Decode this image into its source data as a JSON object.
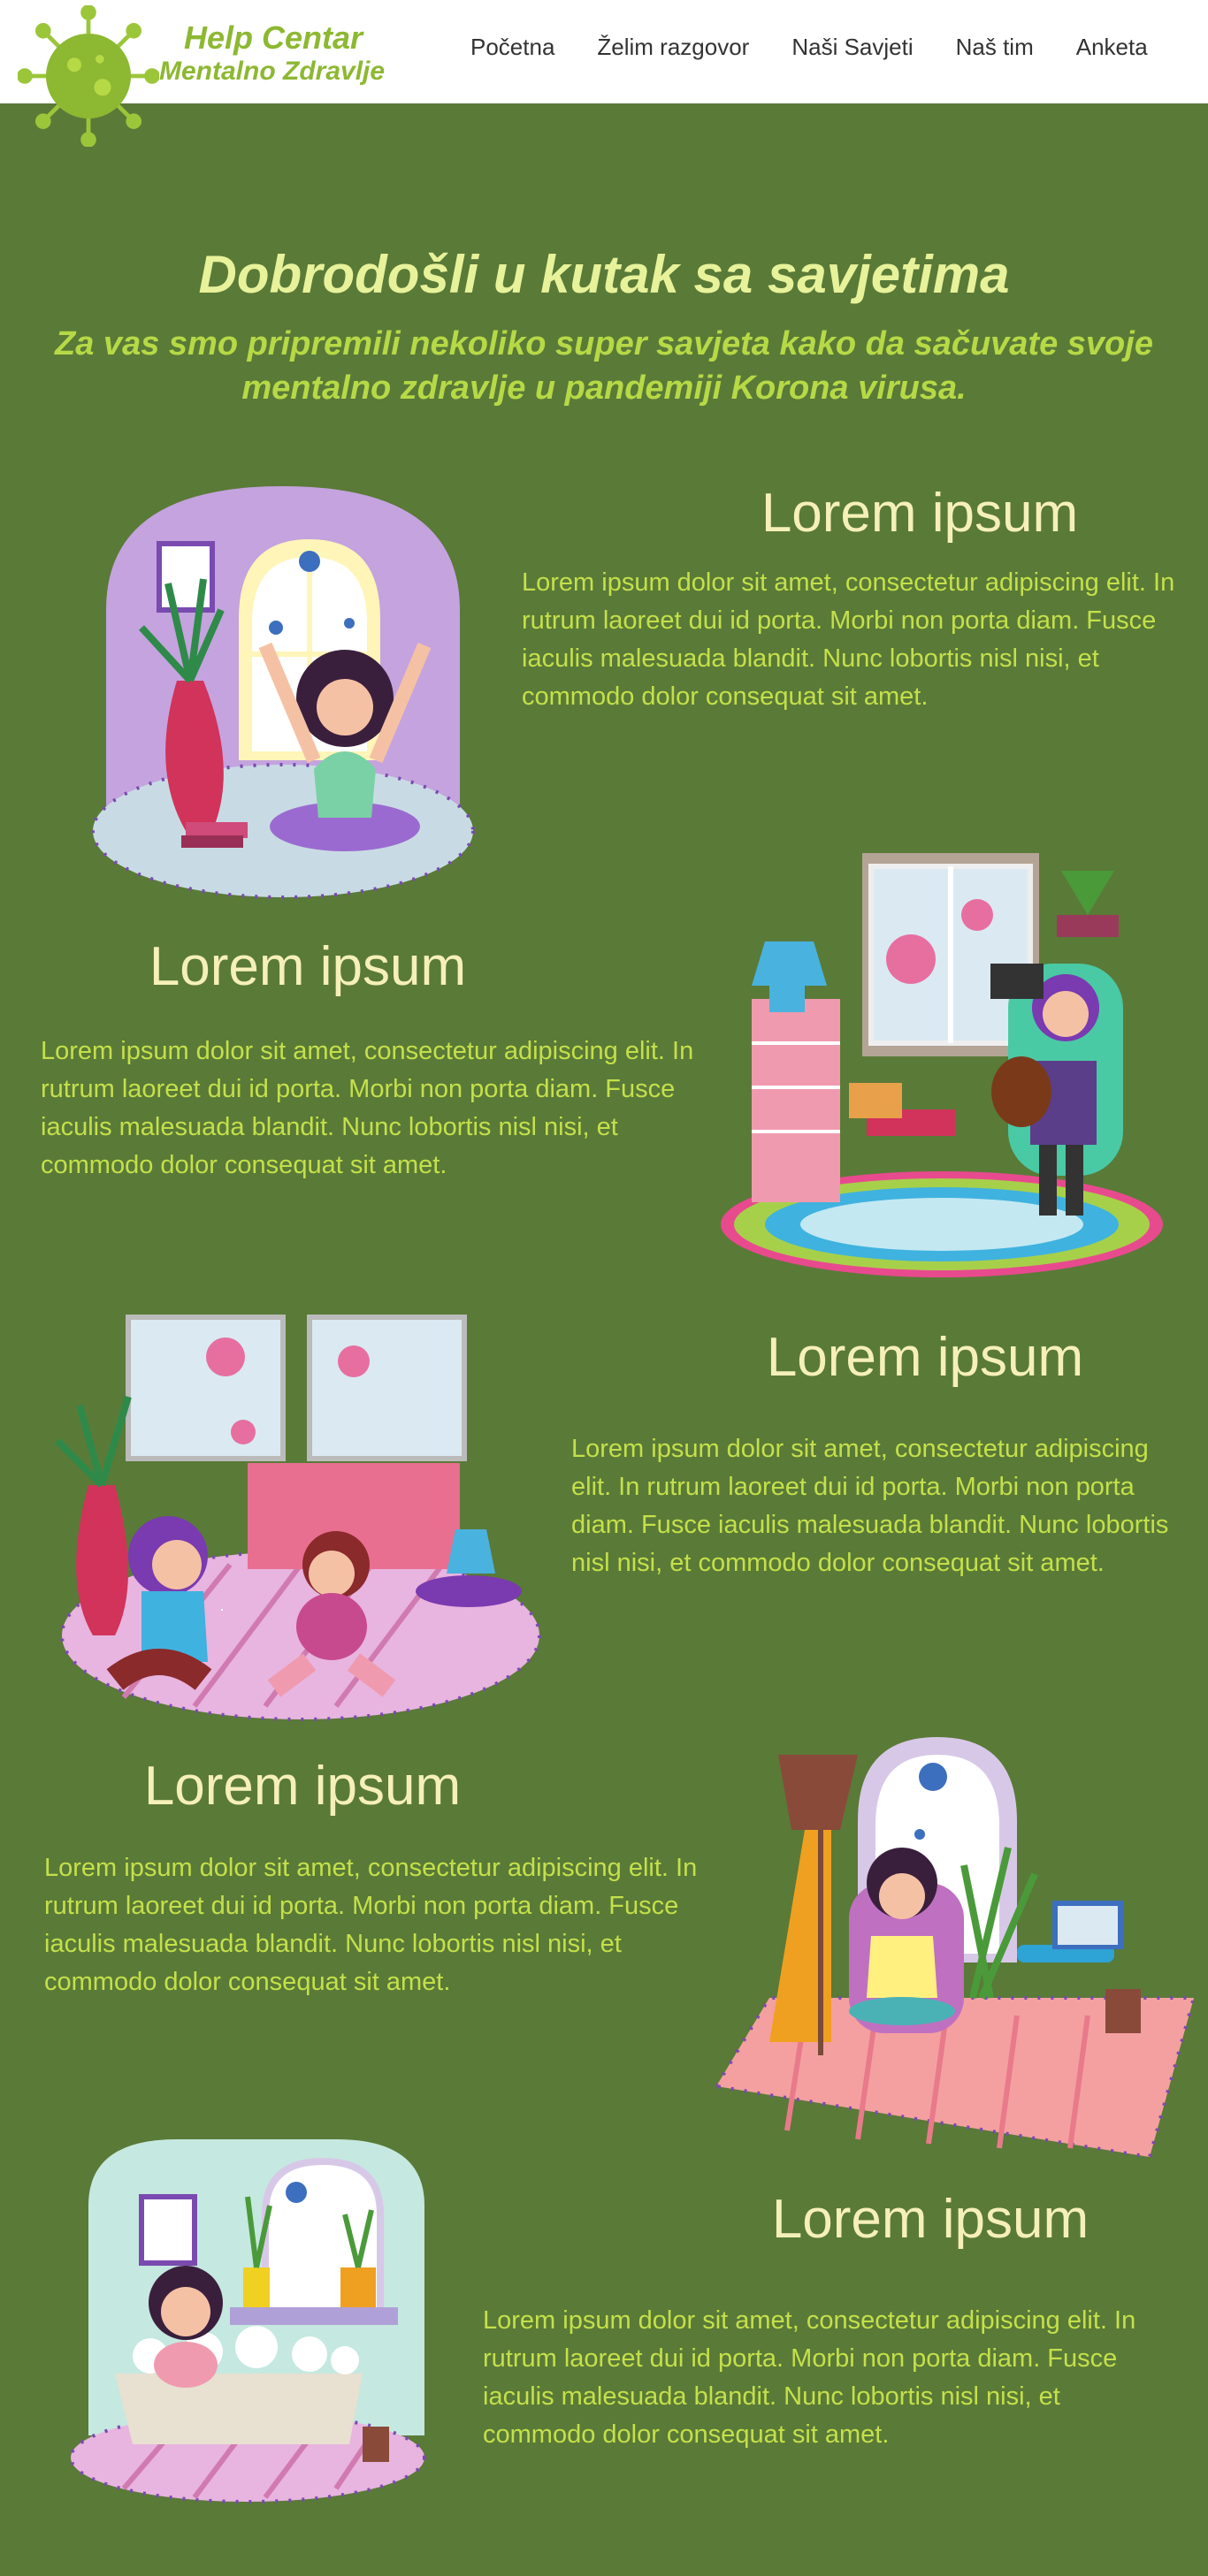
{
  "brand": {
    "line1": "Help Centar",
    "line2": "Mentalno Zdravlje"
  },
  "nav": [
    {
      "label": "Početna"
    },
    {
      "label": "Želim razgovor"
    },
    {
      "label": "Naši Savjeti"
    },
    {
      "label": "Naš tim"
    },
    {
      "label": "Anketa"
    }
  ],
  "hero": {
    "title": "Dobrodošli u kutak sa savjetima",
    "subtitle": "Za vas smo pripremili nekoliko super savjeta kako da sačuvate svoje mentalno zdravlje u pandemiji Korona virusa."
  },
  "sections": [
    {
      "heading": "Lorem ipsum",
      "text": "Lorem ipsum dolor sit amet, consectetur adipiscing elit. In rutrum laoreet dui id porta. Morbi non porta diam. Fusce iaculis malesuada blandit. Nunc lobortis nisl nisi, et commodo dolor consequat sit amet."
    },
    {
      "heading": "Lorem ipsum",
      "text": "Lorem ipsum dolor sit amet, consectetur adipiscing elit. In rutrum laoreet dui id porta. Morbi non porta diam. Fusce iaculis malesuada blandit. Nunc lobortis nisl nisi, et commodo dolor consequat sit amet."
    },
    {
      "heading": "Lorem ipsum",
      "text": "Lorem ipsum dolor sit amet, consectetur adipiscing elit. In rutrum laoreet dui id porta. Morbi non porta diam. Fusce iaculis malesuada blandit. Nunc lobortis nisl nisi, et commodo dolor consequat sit amet."
    },
    {
      "heading": "Lorem ipsum",
      "text": "Lorem ipsum dolor sit amet, consectetur adipiscing elit. In rutrum laoreet dui id porta. Morbi non porta diam. Fusce iaculis malesuada blandit. Nunc lobortis nisl nisi, et commodo dolor consequat sit amet."
    },
    {
      "heading": "Lorem ipsum",
      "text": "Lorem ipsum dolor sit amet, consectetur adipiscing elit. In rutrum laoreet dui id porta. Morbi non porta diam. Fusce iaculis malesuada blandit. Nunc lobortis nisl nisi, et commodo dolor consequat sit amet."
    }
  ],
  "colors": {
    "background": "#5a7a38",
    "brand": "#8db832",
    "heading": "#f6f0b8",
    "text": "#c4e04a"
  }
}
